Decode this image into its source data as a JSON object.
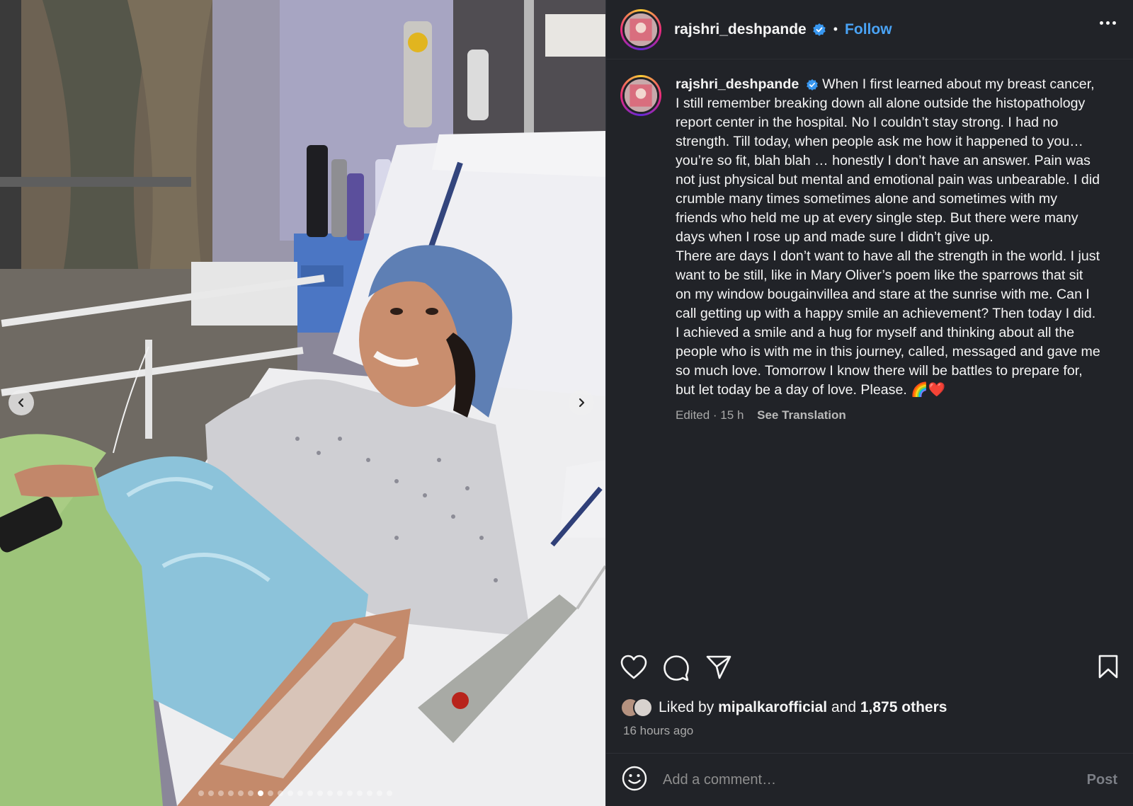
{
  "post": {
    "author": "rajshri_deshpande",
    "verified": true,
    "follow_label": "Follow",
    "separator": "•"
  },
  "caption": {
    "author": "rajshri_deshpande",
    "paragraph1": "When I first learned about my breast cancer, I still remember breaking down all alone outside the histopathology report center in the hospital. No I couldn’t stay strong. I had no strength. Till today, when people ask me how it happened to you… you’re so fit, blah blah … honestly I don’t have an answer. Pain was not just physical but mental and emotional pain was unbearable. I did crumble many times sometimes alone and sometimes with my friends who held me up at every single step. But there were many days when I rose up and made sure I didn’t give up.",
    "paragraph2": "There are days I don’t want to have all the strength in the world. I just want to be still, like in Mary Oliver’s poem like the sparrows that sit on my window bougainvillea and stare at the sunrise with me. Can I call getting up with a happy smile an achievement? Then today I did. I achieved a smile and a hug for myself and thinking about all the people who is with me in this journey, called, messaged and gave me so much love. Tomorrow I know there will be battles to prepare for, but let today be a day of love. Please. 🌈❤️",
    "edited": "Edited · 15 h",
    "translate_label": "See Translation"
  },
  "engagement": {
    "liked_by_prefix": "Liked by",
    "liked_by_user": "mipalkarofficial",
    "and_label": "and",
    "others": "1,875 others",
    "time_ago": "16 hours ago"
  },
  "comment": {
    "placeholder": "Add a comment…",
    "post_label": "Post"
  },
  "carousel": {
    "slide_count": 20,
    "active_index": 6
  },
  "colors": {
    "panel_bg": "#212328",
    "accent": "#4aa3f5",
    "muted": "#a8a8a8"
  },
  "icons": [
    "verified-icon",
    "more-icon",
    "chevron-left-icon",
    "chevron-right-icon",
    "heart-icon",
    "comment-icon",
    "share-icon",
    "bookmark-icon",
    "emoji-icon"
  ]
}
